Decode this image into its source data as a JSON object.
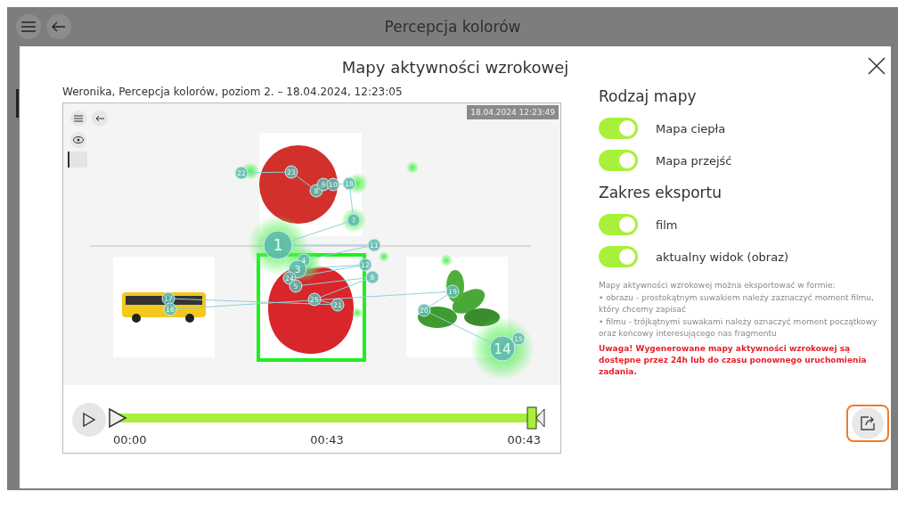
{
  "app_bar": {
    "title": "Percepcja kolorów"
  },
  "dialog": {
    "title": "Mapy aktywności wzrokowej",
    "session": "Weronika, Percepcja kolorów, poziom 2. – 18.04.2024, 12:23:05"
  },
  "player": {
    "timestamp": "18.04.2024 12:23:49",
    "fixations": [
      {
        "label": "22"
      },
      {
        "label": "23"
      },
      {
        "label": "8"
      },
      {
        "label": "9"
      },
      {
        "label": "10"
      },
      {
        "label": "18"
      },
      {
        "label": "7"
      },
      {
        "label": "1"
      },
      {
        "label": "11"
      },
      {
        "label": "4"
      },
      {
        "label": "3"
      },
      {
        "label": "12"
      },
      {
        "label": "24"
      },
      {
        "label": "5"
      },
      {
        "label": "6"
      },
      {
        "label": "25"
      },
      {
        "label": "21"
      },
      {
        "label": "17"
      },
      {
        "label": "16"
      },
      {
        "label": "19"
      },
      {
        "label": "20"
      },
      {
        "label": "14"
      },
      {
        "label": "15"
      }
    ],
    "timeline": {
      "level": 1,
      "start": "00:00",
      "current": "00:43",
      "end": "00:43"
    }
  },
  "sections": [
    {
      "title": "Rodzaj mapy",
      "toggles": [
        {
          "label": "Mapa ciepła",
          "on": true
        },
        {
          "label": "Mapa przejść",
          "on": true
        }
      ]
    },
    {
      "title": "Zakres eksportu",
      "toggles": [
        {
          "label": "film",
          "on": true
        },
        {
          "label": "aktualny widok (obraz)",
          "on": true
        }
      ]
    }
  ],
  "notes": [
    "Mapy aktywności wzrokowej można eksportować w formie:",
    "• obrazu - prostokątnym suwakiem należy zaznaczyć moment filmu, który chcemy zapisać",
    "• filmu - trójkątnymi suwakami należy oznaczyć moment początkowy oraz końcowy interesującego nas fragmentu"
  ],
  "warning": "Uwaga! Wygenerowane mapy aktywności wzrokowej są dostępne przez 24h lub do czasu ponownego uruchomienia zadania."
}
